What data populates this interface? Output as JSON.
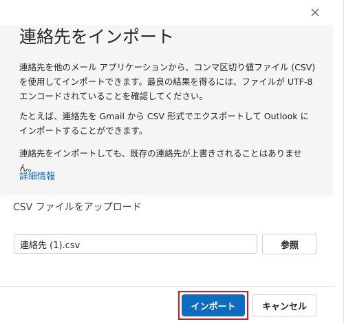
{
  "dialog": {
    "title": "連絡先をインポート",
    "close_icon": "close-icon",
    "paragraphs": [
      "連絡先を他のメール アプリケーションから、コンマ区切り値ファイル (CSV) を使用してインポートできます。最良の結果を得るには、ファイルが UTF-8 エンコードされていることを確認してください。",
      "たとえば、連絡先を Gmail から CSV 形式でエクスポートして Outlook にインポートすることができます。",
      "連絡先をインポートしても、既存の連絡先が上書きされることはありません。"
    ],
    "details_link": "詳細情報"
  },
  "upload": {
    "label": "CSV ファイルをアップロード",
    "file_value": "連絡先 (1).csv",
    "browse_label": "参照"
  },
  "footer": {
    "import_label": "インポート",
    "cancel_label": "キャンセル"
  },
  "colors": {
    "accent": "#0f6cbd",
    "highlight": "#e0141e",
    "panel_background": "#f5f5f5"
  }
}
